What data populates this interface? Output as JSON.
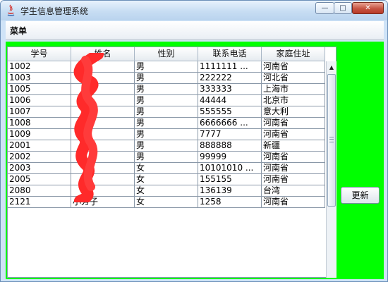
{
  "window": {
    "title": "学生信息管理系统",
    "controls": {
      "minimize": "—",
      "maximize": "□",
      "close": "✕"
    }
  },
  "menubar": {
    "items": [
      {
        "label": "菜单"
      }
    ]
  },
  "table": {
    "columns": [
      "学号",
      "姓名",
      "性别",
      "联系电话",
      "家庭住址"
    ],
    "rows": [
      [
        "1002",
        "",
        "男",
        "1111111          ...",
        "河南省"
      ],
      [
        "1003",
        "",
        "男",
        "222222",
        "河北省"
      ],
      [
        "1005",
        "",
        "男",
        "333333",
        "上海市"
      ],
      [
        "1006",
        "",
        "男",
        "44444",
        "北京市"
      ],
      [
        "1007",
        "",
        "男",
        "555555",
        "意大利"
      ],
      [
        "1008",
        "",
        "男",
        "6666666          ...",
        "河南省"
      ],
      [
        "1009",
        "",
        "男",
        "7777",
        "河南省"
      ],
      [
        "2001",
        "",
        "男",
        "888888",
        "新疆"
      ],
      [
        "2002",
        "",
        "男",
        "99999",
        "河南省"
      ],
      [
        "2003",
        "",
        "女",
        "10101010     ...",
        "河南省"
      ],
      [
        "2005",
        "",
        "女",
        "155155",
        "河南省"
      ],
      [
        "2080",
        "",
        "女",
        "136139",
        "台湾"
      ],
      [
        "2121",
        "小芳子",
        "女",
        "1258",
        "河南省"
      ]
    ]
  },
  "side_panel": {
    "refresh_label": "更新"
  },
  "colors": {
    "panel_background": "#00ff00",
    "redaction": "#ff2a2a"
  }
}
